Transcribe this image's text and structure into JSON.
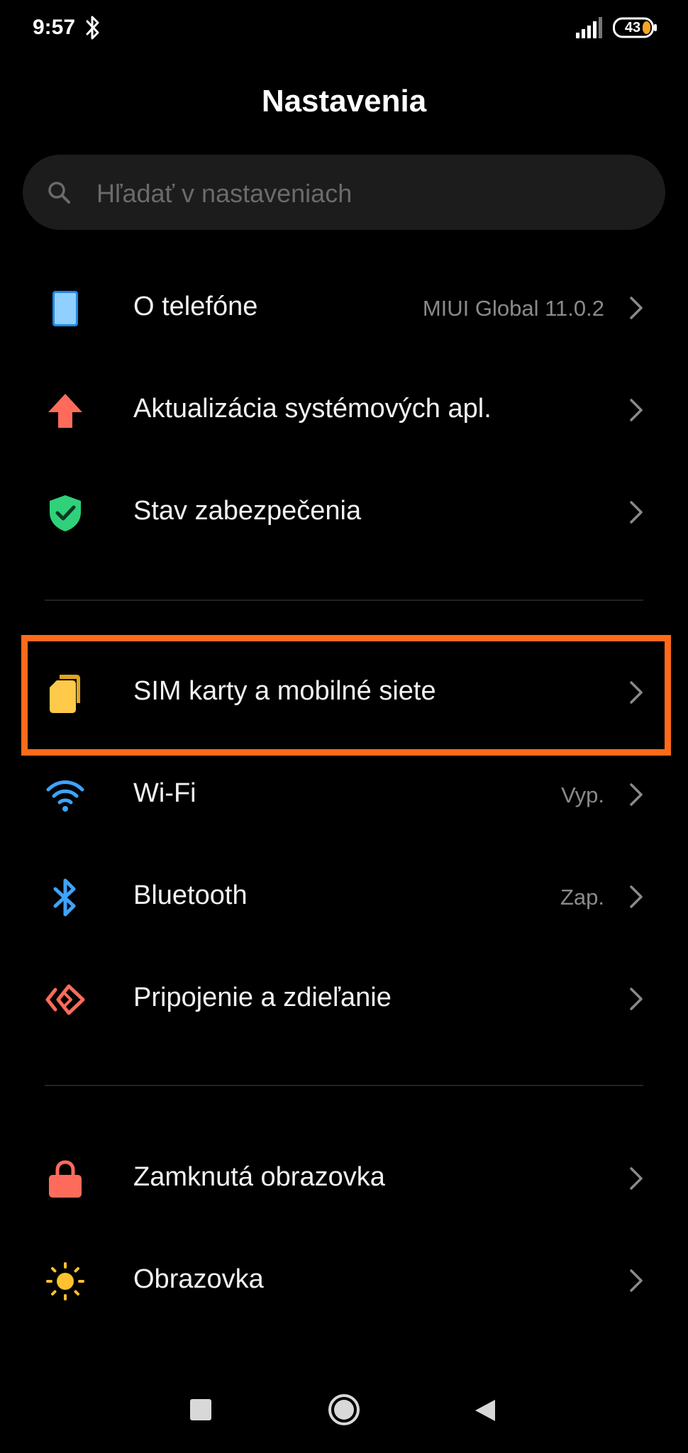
{
  "status": {
    "time": "9:57",
    "battery": "43",
    "bluetooth_icon": "bluetooth-icon",
    "signal_icon": "signal-icon"
  },
  "header": {
    "title": "Nastavenia"
  },
  "search": {
    "placeholder": "Hľadať v nastaveniach",
    "icon": "search-icon"
  },
  "sections": [
    {
      "items": [
        {
          "label": "O telefóne",
          "value": "MIUI Global 11.0.2",
          "icon": "phone-icon",
          "color": "#8fd0ff"
        },
        {
          "label": "Aktualizácia systémových apl.",
          "value": "",
          "icon": "arrow-up-icon",
          "color": "#ff6b5b"
        },
        {
          "label": "Stav zabezpečenia",
          "value": "",
          "icon": "shield-check-icon",
          "color": "#2fd17a"
        }
      ]
    },
    {
      "items": [
        {
          "label": "SIM karty a mobilné siete",
          "value": "",
          "icon": "sim-card-icon",
          "color": "#ffc94a",
          "highlighted": true
        },
        {
          "label": "Wi-Fi",
          "value": "Vyp.",
          "icon": "wifi-icon",
          "color": "#3ea3ff"
        },
        {
          "label": "Bluetooth",
          "value": "Zap.",
          "icon": "bluetooth-icon",
          "color": "#3ea3ff"
        },
        {
          "label": "Pripojenie a zdieľanie",
          "value": "",
          "icon": "connection-sharing-icon",
          "color": "#ff6b5b"
        }
      ]
    },
    {
      "items": [
        {
          "label": "Zamknutá obrazovka",
          "value": "",
          "icon": "lock-icon",
          "color": "#ff6b5b"
        },
        {
          "label": "Obrazovka",
          "value": "",
          "icon": "sun-icon",
          "color": "#ffc12e"
        }
      ]
    }
  ],
  "highlight_color": "#ff6a1a",
  "nav": {
    "recents_icon": "recents-icon",
    "home_icon": "home-icon",
    "back_icon": "back-icon"
  }
}
